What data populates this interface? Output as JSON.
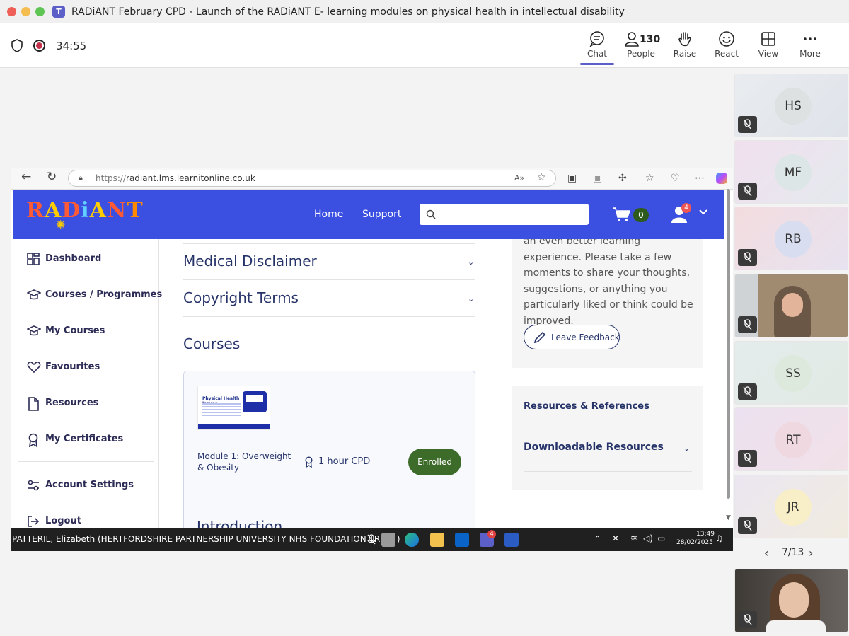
{
  "window": {
    "title": "RADiANT February CPD - Launch of the RADiANT E- learning modules on physical health in intellectual disability"
  },
  "meeting": {
    "timer": "34:55"
  },
  "toolbar": {
    "chat": "Chat",
    "people_count": "130",
    "people": "People",
    "raise": "Raise",
    "react": "React",
    "view": "View",
    "more": "More"
  },
  "browser": {
    "url_prefix": "https://",
    "url_host": "radiant.lms.learnitonline.co.uk"
  },
  "site": {
    "logo": "RADiANT",
    "nav": {
      "home": "Home",
      "support": "Support"
    },
    "cart_count": "0",
    "notification_count": "4",
    "search_placeholder": ""
  },
  "sidebar": {
    "items": [
      {
        "label": "Dashboard"
      },
      {
        "label": "Courses / Programmes"
      },
      {
        "label": "My Courses"
      },
      {
        "label": "Favourites"
      },
      {
        "label": "Resources"
      },
      {
        "label": "My Certificates"
      },
      {
        "label": "Account Settings"
      },
      {
        "label": "Logout"
      }
    ]
  },
  "main": {
    "accordions": [
      "Medical Disclaimer",
      "Copyright Terms"
    ],
    "courses_heading": "Courses",
    "course": {
      "thumb_title": "Physical Health Issues",
      "title": "Module 1: Overweight & Obesity",
      "cpd": "1 hour CPD",
      "status": "Enrolled"
    },
    "introduction": "Introduction"
  },
  "feedback": {
    "text": "an even better learning experience. Please take a few moments to share your thoughts, suggestions, or anything you particularly liked or think could be improved.",
    "button": "Leave Feedback"
  },
  "resources": {
    "title": "Resources & References",
    "downloadable": "Downloadable Resources"
  },
  "taskbar": {
    "caption": "PATTERIL, Elizabeth (HERTFORDSHIRE PARTNERSHIP UNIVERSITY NHS FOUNDATION TRUST)",
    "time": "13:49",
    "date": "28/02/2025",
    "outlook_badge": "4"
  },
  "participants": [
    {
      "initials": "HS",
      "color": "#dde1e1"
    },
    {
      "initials": "MF",
      "color": "#dde6e6"
    },
    {
      "initials": "RB",
      "color": "#d8ddf0"
    },
    {
      "initials": "",
      "color": "#8a7a66"
    },
    {
      "initials": "SS",
      "color": "#dde9dc"
    },
    {
      "initials": "RT",
      "color": "#f0d8e0"
    },
    {
      "initials": "JR",
      "color": "#f8eec8"
    }
  ],
  "pager": {
    "label": "7/13"
  }
}
